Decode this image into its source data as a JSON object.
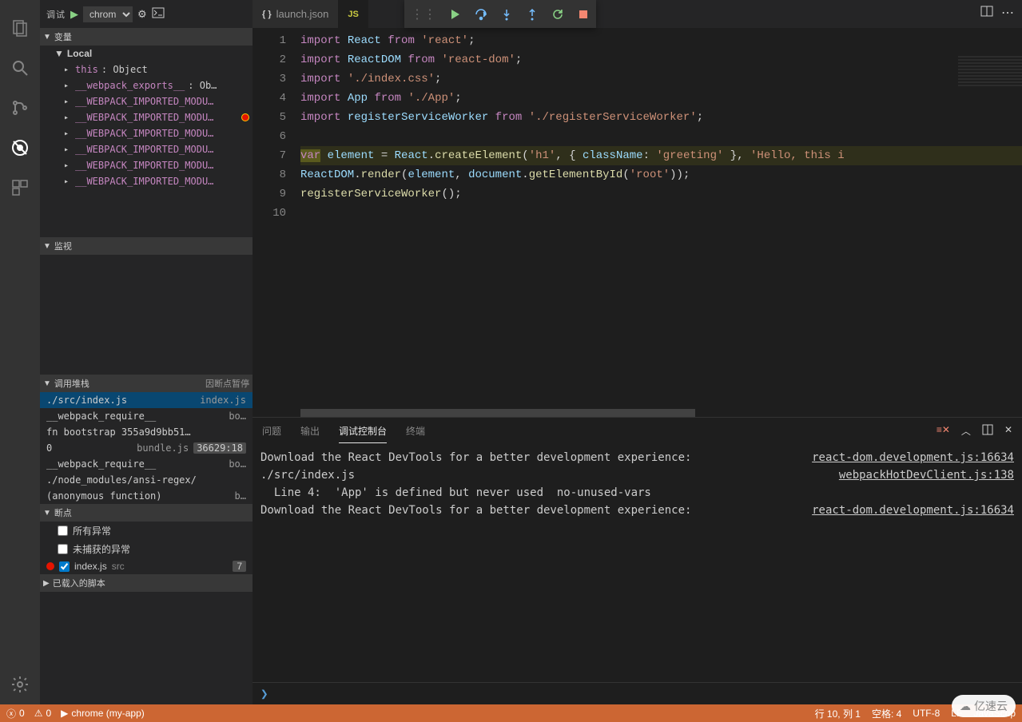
{
  "sidebar": {
    "title": "调试",
    "config": "chrom",
    "sections": {
      "variables": "变量",
      "watch": "监视",
      "callstack": "调用堆栈",
      "callstack_status": "因断点暂停",
      "breakpoints": "断点",
      "loaded": "已载入的脚本"
    },
    "varScope": "Local",
    "vars": [
      {
        "name": "this",
        "val": "Object",
        "sep": ": "
      },
      {
        "name": "__webpack_exports__",
        "val": "Ob…",
        "sep": ": "
      },
      {
        "name": "__WEBPACK_IMPORTED_MODU…",
        "val": "",
        "sep": ""
      },
      {
        "name": "__WEBPACK_IMPORTED_MODU…",
        "val": "",
        "sep": "",
        "bp": true
      },
      {
        "name": "__WEBPACK_IMPORTED_MODU…",
        "val": "",
        "sep": ""
      },
      {
        "name": "__WEBPACK_IMPORTED_MODU…",
        "val": "",
        "sep": ""
      },
      {
        "name": "__WEBPACK_IMPORTED_MODU…",
        "val": "",
        "sep": ""
      },
      {
        "name": "__WEBPACK_IMPORTED_MODU…",
        "val": "",
        "sep": ""
      }
    ],
    "callstack": [
      {
        "fn": "./src/index.js",
        "loc": "index.js",
        "active": true
      },
      {
        "fn": "__webpack_require__",
        "loc": "bo…"
      },
      {
        "fn": "fn   bootstrap 355a9d9bb51…",
        "loc": ""
      },
      {
        "fn": "0",
        "loc": "bundle.js",
        "pos": "36629:18"
      },
      {
        "fn": "__webpack_require__",
        "loc": "bo…"
      },
      {
        "fn": "./node_modules/ansi-regex/",
        "loc": ""
      },
      {
        "fn": "(anonymous function)",
        "loc": "b…"
      }
    ],
    "breakpoints": {
      "all_ex": "所有异常",
      "uncaught": "未捕获的异常",
      "file": "index.js",
      "file_path": "src",
      "count": "7"
    }
  },
  "tabs": [
    {
      "label": "launch.json",
      "icon": "{ }"
    },
    {
      "label": "",
      "icon": "JS"
    }
  ],
  "code": {
    "lines": [
      "1",
      "2",
      "3",
      "4",
      "5",
      "6",
      "7",
      "8",
      "9",
      "10"
    ]
  },
  "panel": {
    "tabs": {
      "problems": "问题",
      "output": "输出",
      "debug": "调试控制台",
      "terminal": "终端"
    },
    "lines": [
      {
        "msg": "Download the React DevTools for a better development experience:",
        "src": "react-dom.development.js:16634"
      },
      {
        "msg": "./src/index.js\n  Line 4:  'App' is defined but never used  no-unused-vars",
        "src": "webpackHotDevClient.js:138"
      },
      {
        "msg": "Download the React DevTools for a better development experience:",
        "src": "react-dom.development.js:16634"
      }
    ],
    "prompt": "❯"
  },
  "statusbar": {
    "errors": "0",
    "warnings": "0",
    "debug": "chrome (my-app)",
    "line": "行 10,  列 1",
    "spaces": "空格: 4",
    "encoding": "UTF-8",
    "eol": "LF",
    "lang": "JavaScrip"
  },
  "watermark": "亿速云"
}
